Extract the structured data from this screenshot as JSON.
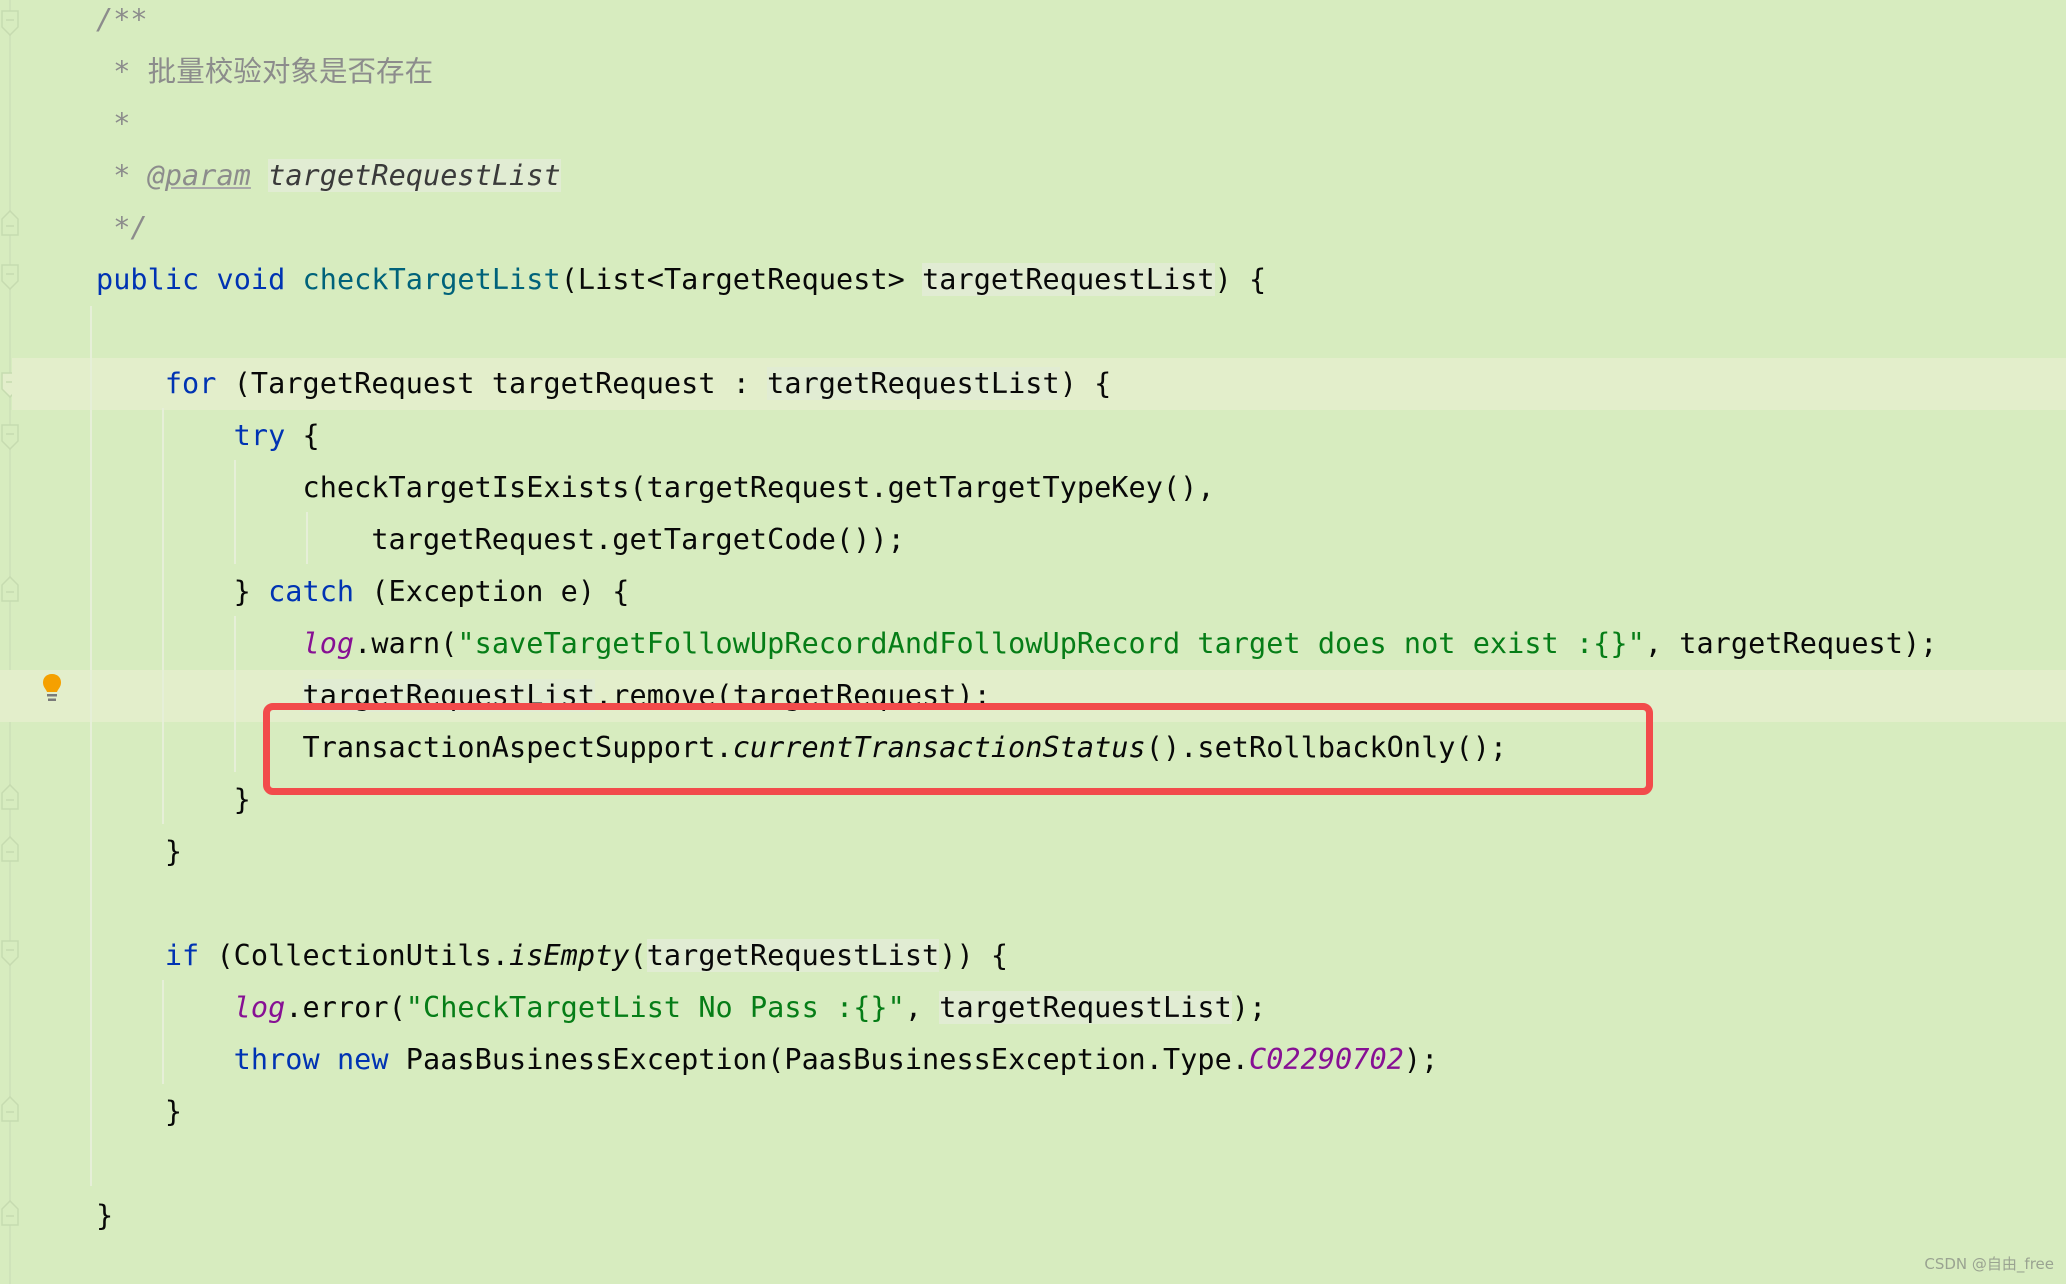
{
  "editor": {
    "language": "java",
    "lines": [
      {
        "tokens": [
          {
            "t": "/**",
            "c": "cmt"
          }
        ]
      },
      {
        "tokens": [
          {
            "t": " * ",
            "c": "cmt"
          },
          {
            "t": "批量校验对象是否存在",
            "c": "cmt-plain"
          }
        ]
      },
      {
        "tokens": [
          {
            "t": " *",
            "c": "cmt"
          }
        ]
      },
      {
        "tokens": [
          {
            "t": " * ",
            "c": "cmt"
          },
          {
            "t": "@param",
            "c": "tag"
          },
          {
            "t": " ",
            "c": "cmt"
          },
          {
            "t": "targetRequestList",
            "c": "param"
          }
        ]
      },
      {
        "tokens": [
          {
            "t": " */",
            "c": "cmt"
          }
        ]
      },
      {
        "tokens": [
          {
            "t": "public",
            "c": "kw"
          },
          {
            "t": " "
          },
          {
            "t": "void",
            "c": "kw"
          },
          {
            "t": " "
          },
          {
            "t": "checkTargetList",
            "c": "fn"
          },
          {
            "t": "(List<TargetRequest> "
          },
          {
            "t": "targetRequestList",
            "c": "hl"
          },
          {
            "t": ") {"
          }
        ]
      },
      {
        "tokens": []
      },
      {
        "tokens": [
          {
            "t": "    "
          },
          {
            "t": "for",
            "c": "kw"
          },
          {
            "t": " (TargetRequest targetRequest : "
          },
          {
            "t": "targetRequestList",
            "c": "hl"
          },
          {
            "t": ") {"
          }
        ]
      },
      {
        "tokens": [
          {
            "t": "        "
          },
          {
            "t": "try",
            "c": "kw"
          },
          {
            "t": " {"
          }
        ]
      },
      {
        "tokens": [
          {
            "t": "            checkTargetIsExists(targetRequest.getTargetTypeKey(),"
          }
        ]
      },
      {
        "tokens": [
          {
            "t": "                targetRequest.getTargetCode());"
          }
        ]
      },
      {
        "tokens": [
          {
            "t": "        } "
          },
          {
            "t": "catch",
            "c": "kw"
          },
          {
            "t": " (Exception e) {"
          }
        ]
      },
      {
        "tokens": [
          {
            "t": "            "
          },
          {
            "t": "log",
            "c": "static-field"
          },
          {
            "t": ".warn("
          },
          {
            "t": "\"saveTargetFollowUpRecordAndFollowUpRecord target does not exist :{}\"",
            "c": "str"
          },
          {
            "t": ", targetRequest);"
          }
        ]
      },
      {
        "tokens": [
          {
            "t": "            "
          },
          {
            "t": "targetRequestList",
            "c": "hl"
          },
          {
            "t": ".remove(targetRequest);"
          }
        ]
      },
      {
        "tokens": [
          {
            "t": "            TransactionAspectSupport."
          },
          {
            "t": "currentTransactionStatus",
            "c": "italic"
          },
          {
            "t": "().setRollbackOnly();"
          }
        ]
      },
      {
        "tokens": [
          {
            "t": "        }"
          }
        ]
      },
      {
        "tokens": [
          {
            "t": "    }"
          }
        ]
      },
      {
        "tokens": []
      },
      {
        "tokens": [
          {
            "t": "    "
          },
          {
            "t": "if",
            "c": "kw"
          },
          {
            "t": " (CollectionUtils."
          },
          {
            "t": "isEmpty",
            "c": "italic"
          },
          {
            "t": "("
          },
          {
            "t": "targetRequestList",
            "c": "hl"
          },
          {
            "t": ")) {"
          }
        ]
      },
      {
        "tokens": [
          {
            "t": "        "
          },
          {
            "t": "log",
            "c": "static-field"
          },
          {
            "t": ".error("
          },
          {
            "t": "\"CheckTargetList No Pass :{}\"",
            "c": "str"
          },
          {
            "t": ", "
          },
          {
            "t": "targetRequestList",
            "c": "hl"
          },
          {
            "t": ");"
          }
        ]
      },
      {
        "tokens": [
          {
            "t": "        "
          },
          {
            "t": "throw",
            "c": "kw"
          },
          {
            "t": " "
          },
          {
            "t": "new",
            "c": "kw"
          },
          {
            "t": " PaasBusinessException(PaasBusinessException.Type."
          },
          {
            "t": "C02290702",
            "c": "static-field"
          },
          {
            "t": ");"
          }
        ]
      },
      {
        "tokens": [
          {
            "t": "    }"
          }
        ]
      },
      {
        "tokens": []
      },
      {
        "tokens": [
          {
            "t": "}"
          }
        ]
      }
    ],
    "caret_line": 8,
    "hint_line": 14,
    "highlighted_line": 15
  },
  "gutter": {
    "intention_icon": "lightbulb-icon"
  },
  "colors": {
    "background": "#d7ecbf",
    "keyword": "#0033b3",
    "method_declaration": "#00627a",
    "string": "#067d17",
    "comment": "#8c8c8c",
    "static_field": "#871094",
    "annotation_box": "#f24b4b",
    "lightbulb": "#f5a000"
  },
  "watermark": "CSDN @自由_free"
}
